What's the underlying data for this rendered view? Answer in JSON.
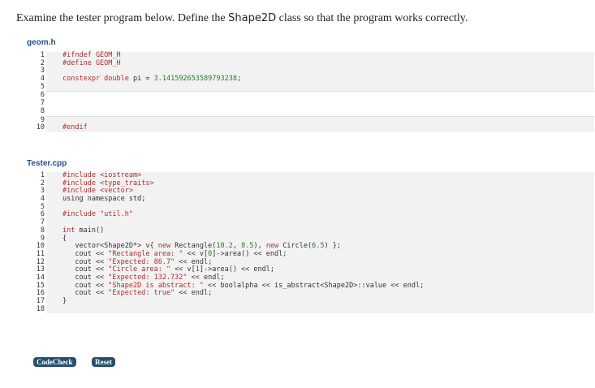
{
  "prompt": {
    "before": "Examine the tester program below. Define the ",
    "class_name": "Shape2D",
    "after": " class so that the program works correctly."
  },
  "files": {
    "geom_name": "geom.h",
    "tester_name": "Tester.cpp"
  },
  "geom_lines": {
    "l1": "#ifndef GEOM_H",
    "l2": "#define GEOM_H",
    "l4_type": "constexpr double",
    "l4_rest": " pi = ",
    "l4_num": "3.141592653589793238",
    "l4_end": ";",
    "l10": "#endif"
  },
  "tester_lines": {
    "l1_dir": "#include ",
    "l1_hdr": "<iostream>",
    "l2_dir": "#include ",
    "l2_hdr": "<type_traits>",
    "l3_dir": "#include ",
    "l3_hdr": "<vector>",
    "l4": "using namespace std;",
    "l6_dir": "#include ",
    "l6_hdr": "\"util.h\"",
    "l8_kw": "int",
    "l8_rest": " main()",
    "l9": "{",
    "l10_a": "   vector<Shape2D*> v{ ",
    "l10_new1": "new",
    "l10_b": " Rectangle(",
    "l10_n1": "10.2",
    "l10_c": ", ",
    "l10_n2": "8.5",
    "l10_d": "), ",
    "l10_new2": "new",
    "l10_e": " Circle(",
    "l10_n3": "6.5",
    "l10_f": ") };",
    "l11_a": "   cout << ",
    "l11_s": "\"Rectangle area: \"",
    "l11_b": " << v[",
    "l11_n": "0",
    "l11_c": "]->area() << endl;",
    "l12_a": "   cout << ",
    "l12_s": "\"Expected: 86.7\"",
    "l12_b": " << endl;",
    "l13_a": "   cout << ",
    "l13_s": "\"Circle area: \"",
    "l13_b": " << v[",
    "l13_n": "1",
    "l13_c": "]->area() << endl;",
    "l14_a": "   cout << ",
    "l14_s": "\"Expected: 132.732\"",
    "l14_b": " << endl;",
    "l15_a": "   cout << ",
    "l15_s": "\"Shape2D is abstract: \"",
    "l15_b": " << boolalpha << is_abstract<Shape2D>::value << endl;",
    "l16_a": "   cout << ",
    "l16_s": "\"Expected: true\"",
    "l16_b": " << endl;",
    "l17": "}"
  },
  "line_numbers": [
    "1",
    "2",
    "3",
    "4",
    "5",
    "6",
    "7",
    "8",
    "9",
    "10",
    "11",
    "12",
    "13",
    "14",
    "15",
    "16",
    "17",
    "18"
  ],
  "buttons": {
    "codecheck": "CodeCheck",
    "reset": "Reset"
  }
}
